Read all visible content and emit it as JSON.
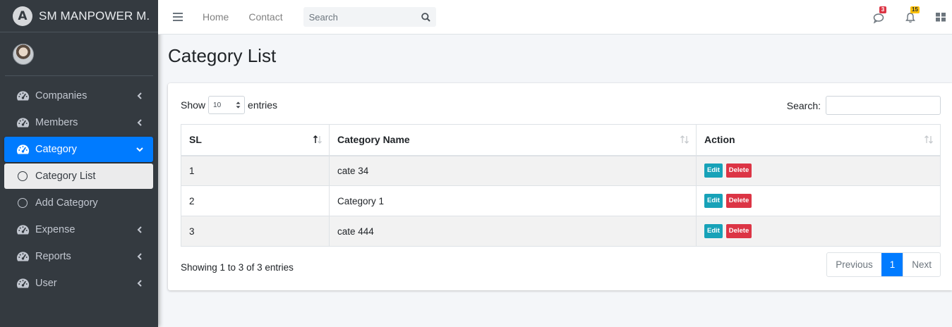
{
  "brand": {
    "logo_letter": "A",
    "name": "SM MANPOWER M."
  },
  "sidebar": {
    "items": [
      {
        "label": "Companies",
        "icon": "tachometer-icon"
      },
      {
        "label": "Members",
        "icon": "tachometer-icon"
      },
      {
        "label": "Category",
        "icon": "tachometer-icon",
        "active": true,
        "expanded": true
      },
      {
        "label": "Category List",
        "icon": "circle-icon",
        "sub": true,
        "active": true
      },
      {
        "label": "Add Category",
        "icon": "circle-icon",
        "sub": true
      },
      {
        "label": "Expense",
        "icon": "tachometer-icon"
      },
      {
        "label": "Reports",
        "icon": "tachometer-icon"
      },
      {
        "label": "User",
        "icon": "tachometer-icon"
      }
    ]
  },
  "navbar": {
    "links": [
      "Home",
      "Contact"
    ],
    "search_placeholder": "Search",
    "messages_count": "3",
    "notifications_count": "15"
  },
  "page": {
    "title": "Category List"
  },
  "table_controls": {
    "show_label": "Show",
    "entries_value": "10",
    "entries_label": "entries",
    "search_label": "Search:",
    "search_value": ""
  },
  "table": {
    "columns": [
      "SL",
      "Category Name",
      "Action"
    ],
    "rows": [
      {
        "sl": "1",
        "name": "cate 34"
      },
      {
        "sl": "2",
        "name": "Category 1"
      },
      {
        "sl": "3",
        "name": "cate 444"
      }
    ],
    "edit_label": "Edit",
    "delete_label": "Delete"
  },
  "footer": {
    "info": "Showing 1 to 3 of 3 entries",
    "prev": "Previous",
    "current_page": "1",
    "next": "Next"
  },
  "colors": {
    "sidebar_bg": "#343a40",
    "primary": "#007bff",
    "info": "#17a2b8",
    "danger": "#dc3545",
    "warning": "#ffc107"
  }
}
